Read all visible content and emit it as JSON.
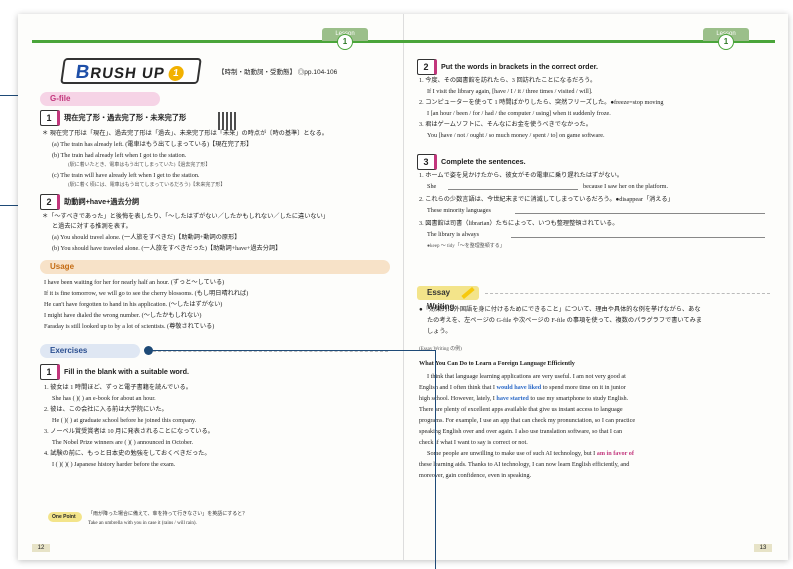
{
  "left": {
    "lesson_tab": "Lesson",
    "lesson_num": "1",
    "brush_big": "B",
    "brush_rest": "RUSH UP",
    "brush_num": "1",
    "subtitle": "【時制・助動詞・受動態】 ◎pp.104-106",
    "gfile": "G-file",
    "s1_num": "1",
    "s1_title": "現在完了形・過去完了形・未来完了形",
    "s1_note": "＊ 現在完了形は「現在」、過去完了形は「過去」、未来完了形は「未来」の時点が〔時の基準〕となる。",
    "s1_a": "(a) The train has already left. (電車はもう出てしまっている)【現在完了形】",
    "s1_b": "(b) The train had already left when I got to the station.",
    "s1_b2": "(駅に着いたとき、電車はもう出てしまっていた)【過去完了形】",
    "s1_c": "(c) The train will have already left when I get to the station.",
    "s1_c2": "(駅に着く頃には、電車はもう出てしまっているだろう)【未来完了形】",
    "s2_num": "2",
    "s2_title": "助動詞+have+過去分詞",
    "s2_note": "＊「～すべきであった」と後悔を表したり、「～したはずがない／したかもしれない／したに違いない」",
    "s2_note2": "と過去に対する推測を表す。",
    "s2_a": "(a) You should travel alone. (一人旅をすべきだ)【助動詞+動詞の原形】",
    "s2_b": "(b) You should have traveled alone. (一人旅をすべきだった)【助動詞+have+過去分詞】",
    "usage": "Usage",
    "u1": "I have been waiting for her for nearly half an hour. (ずっと～している)",
    "u2": "If it is fine tomorrow, we will go to see the cherry blossoms. (もし明日晴れれば)",
    "u3": "He can't have forgotten to hand in his application. (～したはずがない)",
    "u4": "I might have dialed the wrong number. (～したかもしれない)",
    "u5": "Faraday is still looked up to by a lot of scientists. (尊敬されている)",
    "exercises": "Exercises",
    "e_num": "1",
    "e_title": "Fill in the blank with a suitable word.",
    "e1": "1. 彼女は 1 時間ほど、ずっと電子書籍を読んでいる。",
    "e1b": "She has (        )(        ) an e-book for about an hour.",
    "e2": "2. 彼は、この会社に入る前は大学院にいた。",
    "e2b": "He (        )(        ) at graduate school before he joined this company.",
    "e3": "3. ノーベル賞受賞者は 10 月に発表されることになっている。",
    "e3b": "The Nobel Prize winners are (        )(        ) announced in October.",
    "e4": "4. 試験の前に、もっと日本史の勉強をしておくべきだった。",
    "e4b": "I (        )(        )(        ) Japanese history harder before the exam.",
    "onepoint": "One Point",
    "op_jp": "「雨が降った場合に備えて、傘を持って行きなさい」を英語にすると？",
    "op_en": "Take an umbrella with you in case it (rains / will rain).",
    "page": "12"
  },
  "right": {
    "lesson_tab": "Lesson",
    "lesson_num": "1",
    "s2_num": "2",
    "s2_title": "Put the words in brackets in the correct order.",
    "r1": "1. 今度、その図書館を訪れたら、3 回訪れたことになるだろう。",
    "r1b": "If I visit the library again, [have / I / it / three times / visited / will].",
    "r2": "2. コンピューターを使って 1 時間ばかりしたら、突然フリーズした。●freeze=stop moving",
    "r2b": "I [an hour / been / for / had / the computer / using] when it suddenly froze.",
    "r3": "3. 君はゲームソフトに、そんなにお金を使うべきでなかった。",
    "r3b": "You [have / not / ought / so much money / spent / to] on game software.",
    "s3_num": "3",
    "s3_title": "Complete the sentences.",
    "c1": "1. ホームで姿を見かけたから、彼女がその電車に乗り遅れたはずがない。",
    "c1b": "She",
    "c1c": "because I saw her on the platform.",
    "c2": "2. これらの少数言語は、今世紀末までに消滅してしまっているだろう。●disappear「消える」",
    "c2b": "These minority languages",
    "c3": "3. 図書館は司書（librarian）たちによって、いつも整理整頓されている。",
    "c3b": "The library is always",
    "c3n": "●keep ～ tidy「～を整理整頓する」",
    "essay": "Essay Writing",
    "ew1": "●「効果的に外国語を身に付けるためにできること」について、理由や具体的な例を挙げながら、あな",
    "ew2": "たの考えを、左ページの G-file や次ページの F-file の事項を使って、複数のパラグラフで書いてみま",
    "ew3": "しょう。",
    "example": "(Essay Writing の例)",
    "essay_title": "What You Can Do to Learn a Foreign Language Efficiently",
    "p1": "I think that language learning applications are very useful. I am not very good at",
    "p2a": "English and I often think that I ",
    "p2h": "would have liked",
    "p2b": " to spend more time on it in junior",
    "p3a": "high school. However, lately, I ",
    "p3h": "have started",
    "p3b": " to use my smartphone to study English.",
    "p4": "There are plenty of excellent apps available that give us instant access to language",
    "p5": "programs. For example, I use an app that can check my pronunciation, so I can practice",
    "p6": "speaking English over and over again. I also use translation software, so that I can",
    "p7": "check if what I want to say is correct or not.",
    "p8a": "Some people are unwilling to make use of such AI technology, but I ",
    "p8h": "am in favor of",
    "p9": "these learning aids. Thanks to AI technology, I can now learn English efficiently, and",
    "p10": "moreover, gain confidence, even in speaking.",
    "page": "13"
  }
}
